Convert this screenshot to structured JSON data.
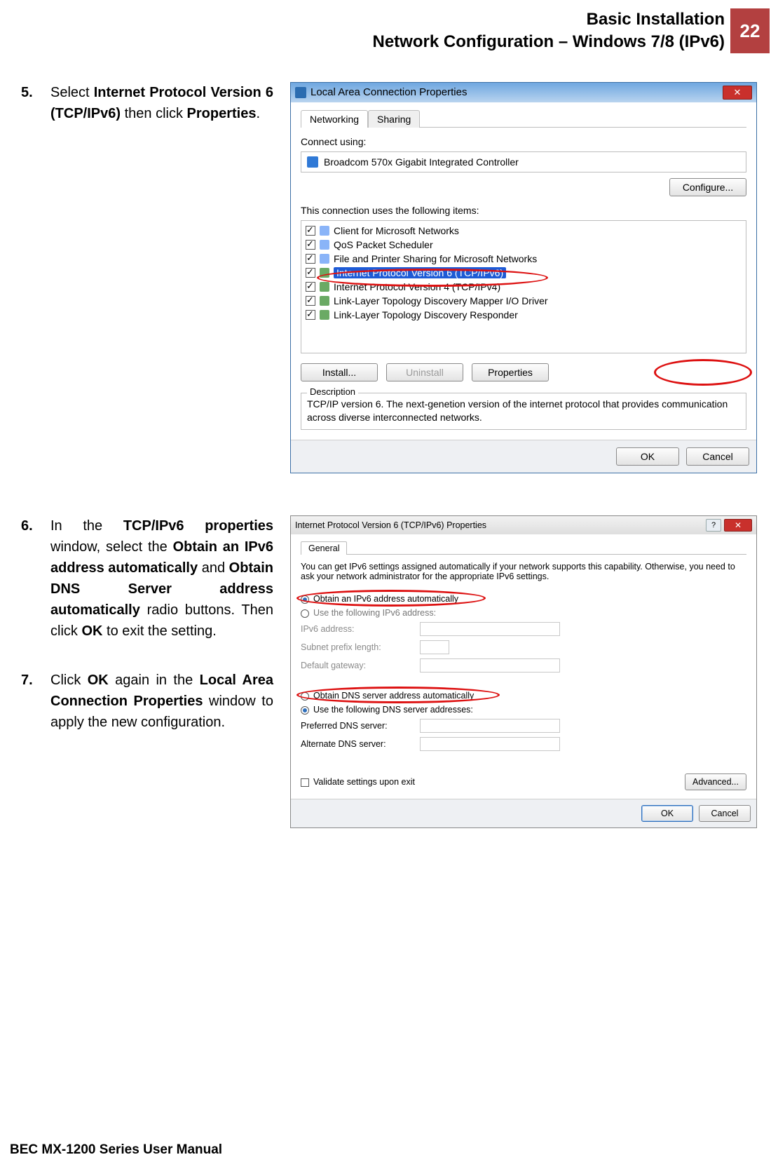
{
  "header": {
    "line1": "Basic Installation",
    "line2": "Network Configuration – Windows 7/8 (IPv6)",
    "page": "22"
  },
  "steps": {
    "s5": {
      "num": "5.",
      "pre": "Select ",
      "b1": "Internet Protocol Version 6 (TCP/IPv6)",
      "mid": " then click ",
      "b2": "Properties",
      "post": "."
    },
    "s6": {
      "num": "6.",
      "pre": "In the ",
      "b1": "TCP/IPv6 properties",
      "t1": " window, select the ",
      "b2": "Obtain an IPv6 address automatically",
      "t2": " and ",
      "b3": "Obtain DNS Server address automatically",
      "t3": " radio buttons. Then click ",
      "b4": "OK",
      "t4": " to exit the setting."
    },
    "s7": {
      "num": "7.",
      "pre": "Click ",
      "b1": "OK",
      "t1": " again in the ",
      "b2": "Local Area Connection Properties",
      "t2": " window to apply the new configuration."
    }
  },
  "dialogA": {
    "title": "Local Area Connection Properties",
    "tabs": {
      "net": "Networking",
      "share": "Sharing"
    },
    "connectUsing": "Connect using:",
    "adapter": "Broadcom 570x Gigabit Integrated Controller",
    "configure": "Configure...",
    "itemsLabel": "This connection uses the following items:",
    "items": [
      "Client for Microsoft Networks",
      "QoS Packet Scheduler",
      "File and Printer Sharing for Microsoft Networks",
      "Internet Protocol Version 6  (TCP/IPv6)",
      "Internet Protocol Version 4  (TCP/IPv4)",
      "Link-Layer Topology Discovery Mapper I/O Driver",
      "Link-Layer Topology Discovery Responder"
    ],
    "install": "Install...",
    "uninstall": "Uninstall",
    "properties": "Properties",
    "descLegend": "Description",
    "desc": "TCP/IP version 6. The next-genetion version of the internet protocol that provides communication across diverse interconnected networks.",
    "ok": "OK",
    "cancel": "Cancel"
  },
  "dialogB": {
    "title": "Internet Protocol Version 6 (TCP/IPv6) Properties",
    "tab": "General",
    "intro": "You can get IPv6 settings assigned automatically if your network supports this capability. Otherwise, you need to ask your network administrator for the appropriate IPv6 settings.",
    "r1": "Obtain an IPv6 address automatically",
    "r2": "Use the following IPv6 address:",
    "f_ip": "IPv6 address:",
    "f_prefix": "Subnet prefix length:",
    "f_gw": "Default gateway:",
    "r3": "Obtain DNS server address automatically",
    "r4": "Use the following DNS server addresses:",
    "f_pdns": "Preferred DNS server:",
    "f_adns": "Alternate DNS server:",
    "validate": "Validate settings upon exit",
    "advanced": "Advanced...",
    "ok": "OK",
    "cancel": "Cancel"
  },
  "footer": "BEC MX-1200 Series User Manual"
}
